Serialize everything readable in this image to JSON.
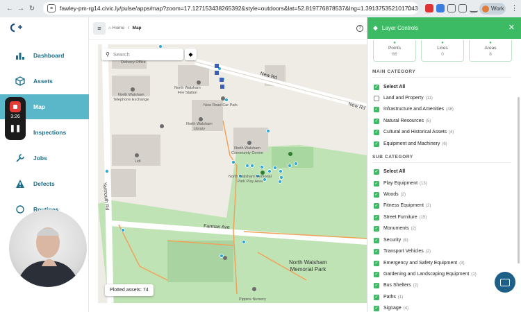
{
  "browser": {
    "url": "fawley-pm-rg14.civic.ly/pulse/apps/map?zoom=17.127153438265392&style=outdoors&lat=52.819776878537&lng=1.3913753521017043",
    "profile_label": "Work"
  },
  "sidebar": {
    "items": [
      {
        "label": "Dashboard",
        "icon": "bar-chart-icon"
      },
      {
        "label": "Assets",
        "icon": "cube-icon"
      },
      {
        "label": "Map",
        "icon": "map-icon"
      },
      {
        "label": "Inspections",
        "icon": "binoculars-icon"
      },
      {
        "label": "Jobs",
        "icon": "wrench-icon"
      },
      {
        "label": "Defects",
        "icon": "warning-icon"
      },
      {
        "label": "Routines",
        "icon": "refresh-icon"
      }
    ]
  },
  "recorder": {
    "time": "3:26"
  },
  "header": {
    "breadcrumb_home": "Home",
    "breadcrumb_sep": "/",
    "breadcrumb_current": "Map"
  },
  "map": {
    "search_placeholder": "Search",
    "plotted_label": "Plotted assets: 74",
    "labels": {
      "delivery": "North Walsham\nDelivery Office",
      "telephone": "North Walsham\nTelephone Exchange",
      "fire": "North Walsham\nFire Station",
      "carpark": "New Road Car Park",
      "library": "North Walsham\nLibrary",
      "lidl": "Lidl",
      "community": "North Walsham\nCommunity Centre",
      "playarea": "North Walsham Memorial\nPark Play Area",
      "newrd1": "New Rd",
      "newrd2": "New Rd",
      "farman": "Farman Ave",
      "yarmouth": "Yarmouth Rd",
      "park": "North Walsham\nMemorial Park",
      "nursery": "Pippins Nursery"
    }
  },
  "panel": {
    "title": "Layer Controls",
    "stats": [
      {
        "label": "Points",
        "value": "66"
      },
      {
        "label": "Lines",
        "value": "0"
      },
      {
        "label": "Areas",
        "value": "8"
      }
    ],
    "main_title": "MAIN CATEGORY",
    "main": [
      {
        "label": "Select All",
        "count": "",
        "checked": true
      },
      {
        "label": "Land and Property",
        "count": "(11)",
        "checked": false
      },
      {
        "label": "Infrastructure and Amenities",
        "count": "(48)",
        "checked": true
      },
      {
        "label": "Natural Resources",
        "count": "(5)",
        "checked": true
      },
      {
        "label": "Cultural and Historical Assets",
        "count": "(4)",
        "checked": true
      },
      {
        "label": "Equipment and Machinery",
        "count": "(6)",
        "checked": true
      }
    ],
    "sub_title": "SUB CATEGORY",
    "sub": [
      {
        "label": "Select All",
        "count": "",
        "checked": true
      },
      {
        "label": "Play Equipment",
        "count": "(13)",
        "checked": true
      },
      {
        "label": "Woods",
        "count": "(2)",
        "checked": true
      },
      {
        "label": "Fitness Equipment",
        "count": "(2)",
        "checked": true
      },
      {
        "label": "Street Furniture",
        "count": "(15)",
        "checked": true
      },
      {
        "label": "Monuments",
        "count": "(2)",
        "checked": true
      },
      {
        "label": "Security",
        "count": "(6)",
        "checked": true
      },
      {
        "label": "Transport Vehicles",
        "count": "(2)",
        "checked": true
      },
      {
        "label": "Emergency and Safety Equipment",
        "count": "(3)",
        "checked": true
      },
      {
        "label": "Gardening and Landscaping Equipment",
        "count": "(1)",
        "checked": true
      },
      {
        "label": "Bus Shelters",
        "count": "(2)",
        "checked": true
      },
      {
        "label": "Paths",
        "count": "(1)",
        "checked": true
      },
      {
        "label": "Signage",
        "count": "(4)",
        "checked": true
      }
    ]
  },
  "colors": {
    "accent": "#3dbb64",
    "nav_active": "#5ab7c9",
    "nav_text": "#1a6e8a",
    "park": "#a8d8a0"
  }
}
